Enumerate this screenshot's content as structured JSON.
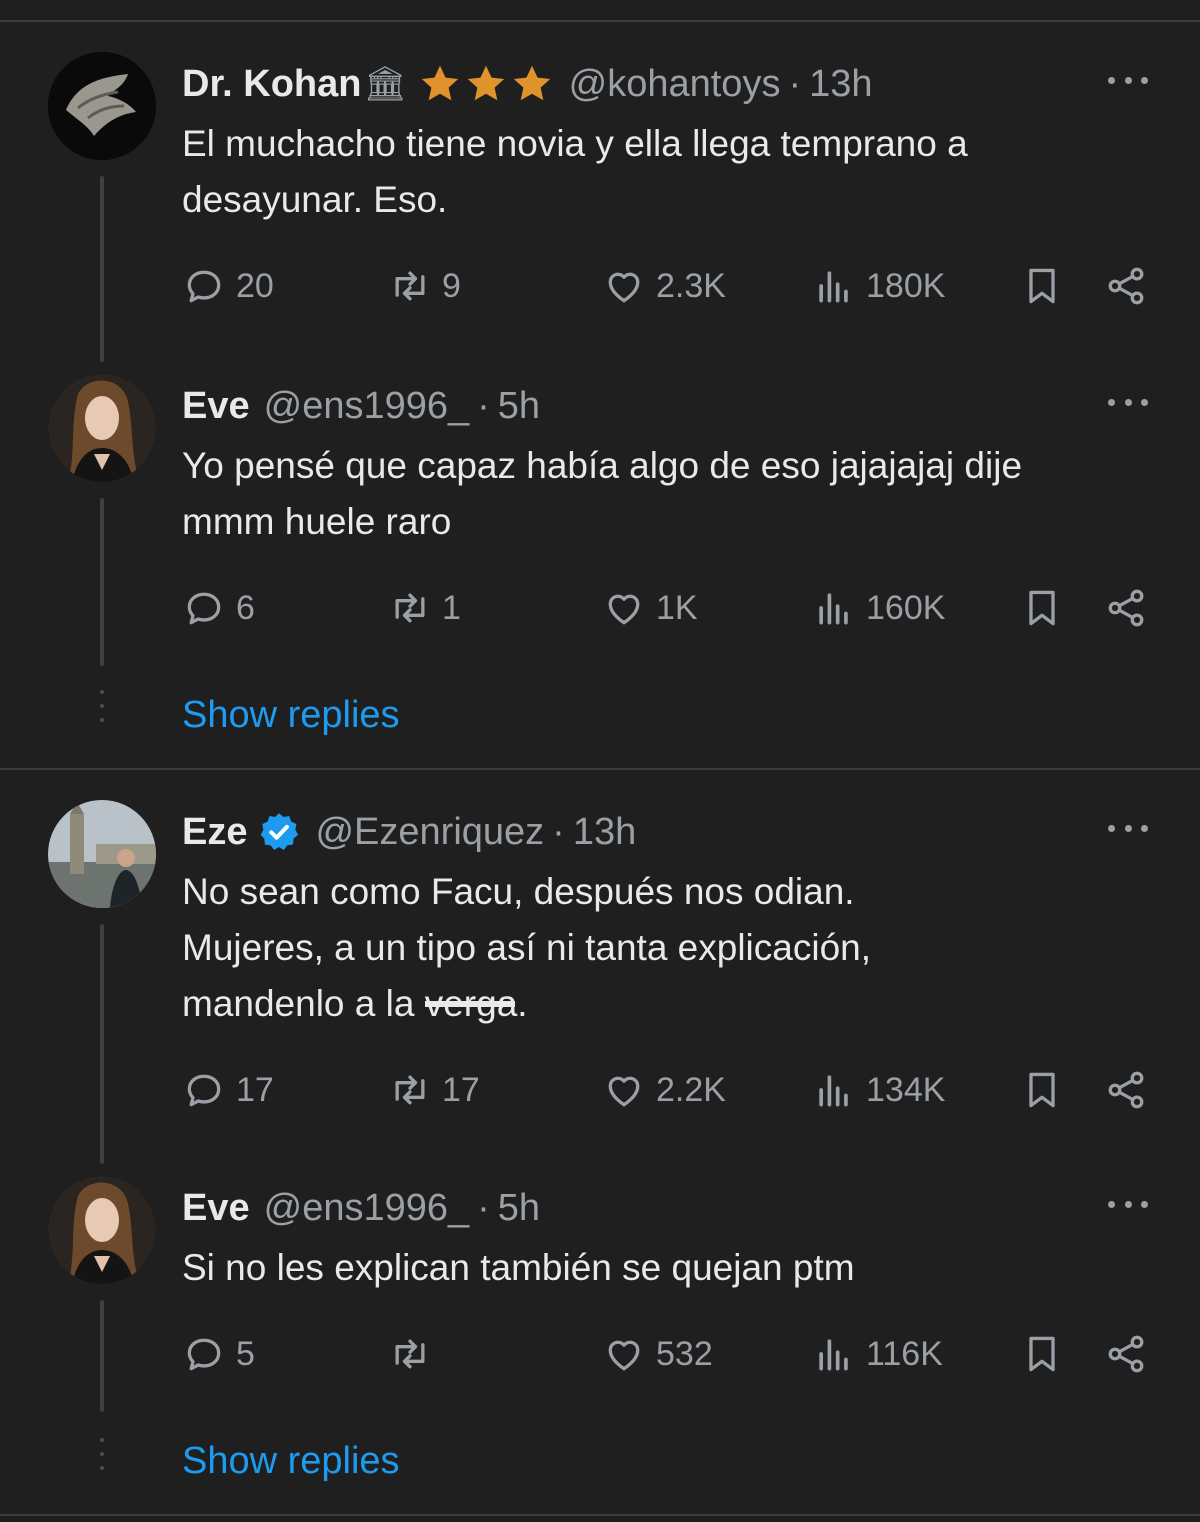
{
  "tweets": [
    {
      "name": "Dr. Kohan",
      "badge": "🏛",
      "handle": "@kohantoys",
      "time": "13h",
      "text_lines": [
        "El muchacho tiene novia y ella llega temprano a",
        "desayunar. Eso."
      ],
      "replies": "20",
      "retweets": "9",
      "likes": "2.3K",
      "views": "180K"
    },
    {
      "name": "Eve",
      "handle": "@ens1996_",
      "time": "5h",
      "text_lines": [
        "Yo pensé que capaz había algo de eso jajajajaj dije",
        "mmm huele raro"
      ],
      "replies": "6",
      "retweets": "1",
      "likes": "1K",
      "views": "160K"
    },
    {
      "name": "Eze",
      "handle": "@Ezenriquez",
      "time": "13h",
      "text_lines": [
        "No sean como Facu, después nos odian.",
        "Mujeres, a un tipo así ni tanta explicación,",
        "mandenlo a la "
      ],
      "redacted_word": "verga",
      "text_end": ".",
      "replies": "17",
      "retweets": "17",
      "likes": "2.2K",
      "views": "134K"
    },
    {
      "name": "Eve",
      "handle": "@ens1996_",
      "time": "5h",
      "text_lines": [
        "Si no les explican también se quejan ptm"
      ],
      "replies": "5",
      "retweets": "",
      "likes": "532",
      "views": "116K"
    }
  ],
  "show_replies_label": "Show replies",
  "separator": "·",
  "colors": {
    "background": "#1f1f1f",
    "text": "#e7e9ea",
    "muted": "#9aa0a5",
    "link": "#1d9bf0",
    "star": "#e0932b",
    "verified": "#1d9bf0"
  },
  "icons": [
    "reply-icon",
    "retweet-icon",
    "like-icon",
    "views-icon",
    "bookmark-icon",
    "share-icon",
    "more-icon",
    "star-icon",
    "verified-icon"
  ]
}
